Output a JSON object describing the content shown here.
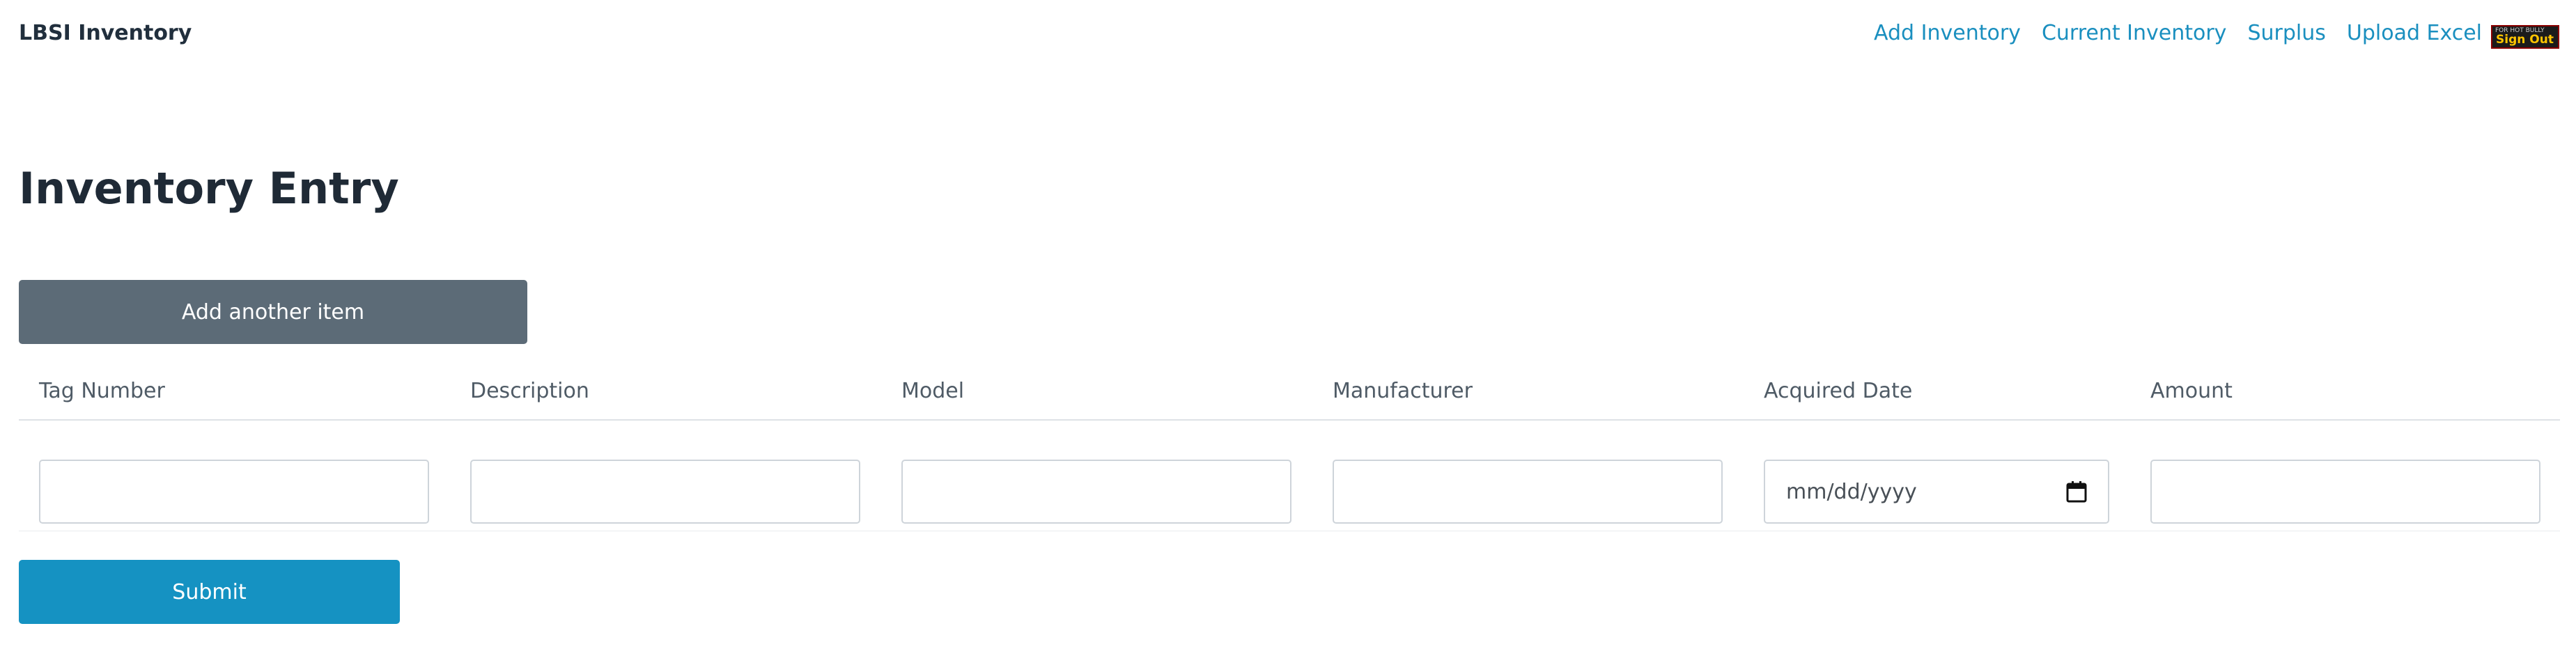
{
  "navbar": {
    "brand": "LBSI Inventory",
    "links": [
      "Add Inventory",
      "Current Inventory",
      "Surplus",
      "Upload Excel"
    ],
    "signout": {
      "small_text": "FOR HOT BULLY",
      "label": "Sign Out"
    }
  },
  "page": {
    "title": "Inventory Entry",
    "add_button_label": "Add another item",
    "submit_button_label": "Submit"
  },
  "table": {
    "headers": [
      "Tag Number",
      "Description",
      "Model",
      "Manufacturer",
      "Acquired Date",
      "Amount"
    ],
    "row": {
      "tag_number": "",
      "description": "",
      "model": "",
      "manufacturer": "",
      "acquired_date_placeholder": "mm/dd/yyyy",
      "amount": ""
    }
  },
  "colors": {
    "brand_text": "#212f3d",
    "link": "#1a8fbf",
    "add_button": "#5c6b77",
    "submit_button": "#1592c2"
  },
  "icons": {
    "calendar": "calendar-icon"
  }
}
